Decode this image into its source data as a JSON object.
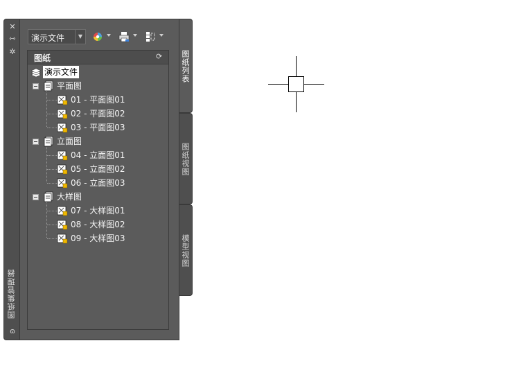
{
  "palette": {
    "title": "图纸集管理器",
    "combo_value": "演示文件",
    "tree_header": "图纸",
    "tabs": [
      "图纸列表",
      "图纸视图",
      "模型视图"
    ],
    "tree": {
      "root": "演示文件",
      "groups": [
        {
          "label": "平面图",
          "sheets": [
            "01 - 平面图01",
            "02 - 平面图02",
            "03 - 平面图03"
          ]
        },
        {
          "label": "立面图",
          "sheets": [
            "04 - 立面图01",
            "05 - 立面图02",
            "06 - 立面图03"
          ]
        },
        {
          "label": "大样图",
          "sheets": [
            "07 - 大样图01",
            "08 - 大样图02",
            "09 - 大样图03"
          ]
        }
      ]
    }
  },
  "icons": {
    "close": "close-icon",
    "autohide": "autohide-icon",
    "properties": "properties-icon",
    "refresh": "refresh-icon",
    "sheetset": "sheet-set-icon",
    "subset": "subset-icon",
    "sheet": "sheet-icon"
  },
  "colors": {
    "panel": "#5b5b5b",
    "strip": "#4f4f4f",
    "sheet_lock": "#f0b800"
  }
}
